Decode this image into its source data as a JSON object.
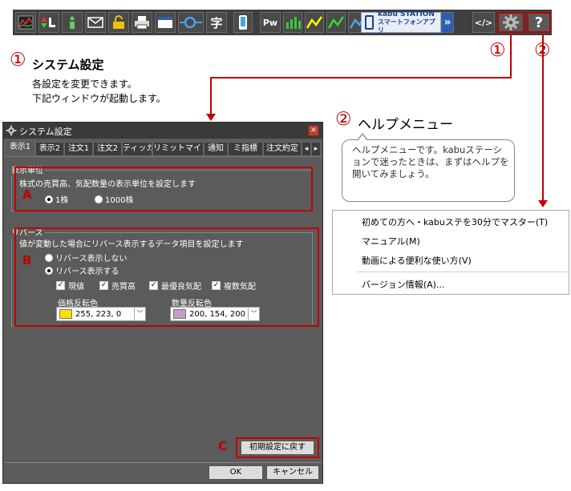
{
  "toolbar": {
    "buttons": [
      {
        "icon": "chart-icon"
      },
      {
        "icon": "up-down-list-icon"
      },
      {
        "icon": "info-icon"
      },
      {
        "icon": "mail-icon"
      },
      {
        "icon": "lock-icon"
      },
      {
        "icon": "printer-icon"
      },
      {
        "icon": "window-icon"
      },
      {
        "icon": "link-icon"
      },
      {
        "icon": "character-icon",
        "label": "字"
      },
      {
        "icon": "phone-icon"
      },
      {
        "icon": "pw-icon",
        "label": "Pw"
      },
      {
        "icon": "bars-chart-icon"
      },
      {
        "icon": "line-chart-yellow-icon"
      },
      {
        "icon": "line-chart-green-icon"
      },
      {
        "icon": "line-chart-blue-icon"
      }
    ],
    "kabu_station_line1": "kabu STATION",
    "kabu_station_line2": "スマートフォンアプリ",
    "more_arrow": "»",
    "code_label": "</>",
    "help_label": "?"
  },
  "callout1": {
    "number": "①",
    "title": "システム設定",
    "desc1": "各設定を変更できます。",
    "desc2": "下記ウィンドウが起動します。",
    "top_number": "①"
  },
  "callout2": {
    "number": "②",
    "title": "ヘルプメニュー",
    "top_number": "②",
    "bubble": "ヘルプメニューです。kabuステーションで迷ったときは、まずはヘルプを開いてみましょう。"
  },
  "dialog": {
    "title": "システム設定",
    "close": "×",
    "tabs": [
      "表示1",
      "表示2",
      "注文1",
      "注文2",
      "ティッカー",
      "リミットマインダー",
      "通知",
      "ミ指標",
      "注文約定"
    ],
    "tab_prev": "◂",
    "tab_next": "▸",
    "group_a": {
      "title": "表示単位",
      "desc": "株式の売買高、気配数量の表示単位を設定します",
      "option1": "1株",
      "option2": "1000株",
      "marker": "A"
    },
    "group_b": {
      "title": "リバース",
      "desc": "値が変動した場合にリバース表示するデータ項目を設定します",
      "radio_off": "リバース表示しない",
      "radio_on": "リバース表示する",
      "checks": [
        "現値",
        "売買高",
        "最優良気配",
        "複数気配"
      ],
      "check_mark": "✓",
      "price_color_label": "価格反転色",
      "price_color_value": "255, 223, 0",
      "price_color": "#ffdf00",
      "qty_color_label": "数量反転色",
      "qty_color_value": "200, 154, 200",
      "qty_color": "#c89ac8",
      "dropdown": "﹀",
      "marker": "B"
    },
    "reset_button": "初期設定に戻す",
    "reset_marker": "C",
    "ok": "OK",
    "cancel": "キャンセル"
  },
  "help_menu": {
    "items": [
      "初めての方へ・kabuステを30分でマスター(T)",
      "マニュアル(M)",
      "動画による便利な使い方(V)",
      "バージョン情報(A)..."
    ]
  },
  "colors": {
    "accent_red": "#c00000"
  }
}
